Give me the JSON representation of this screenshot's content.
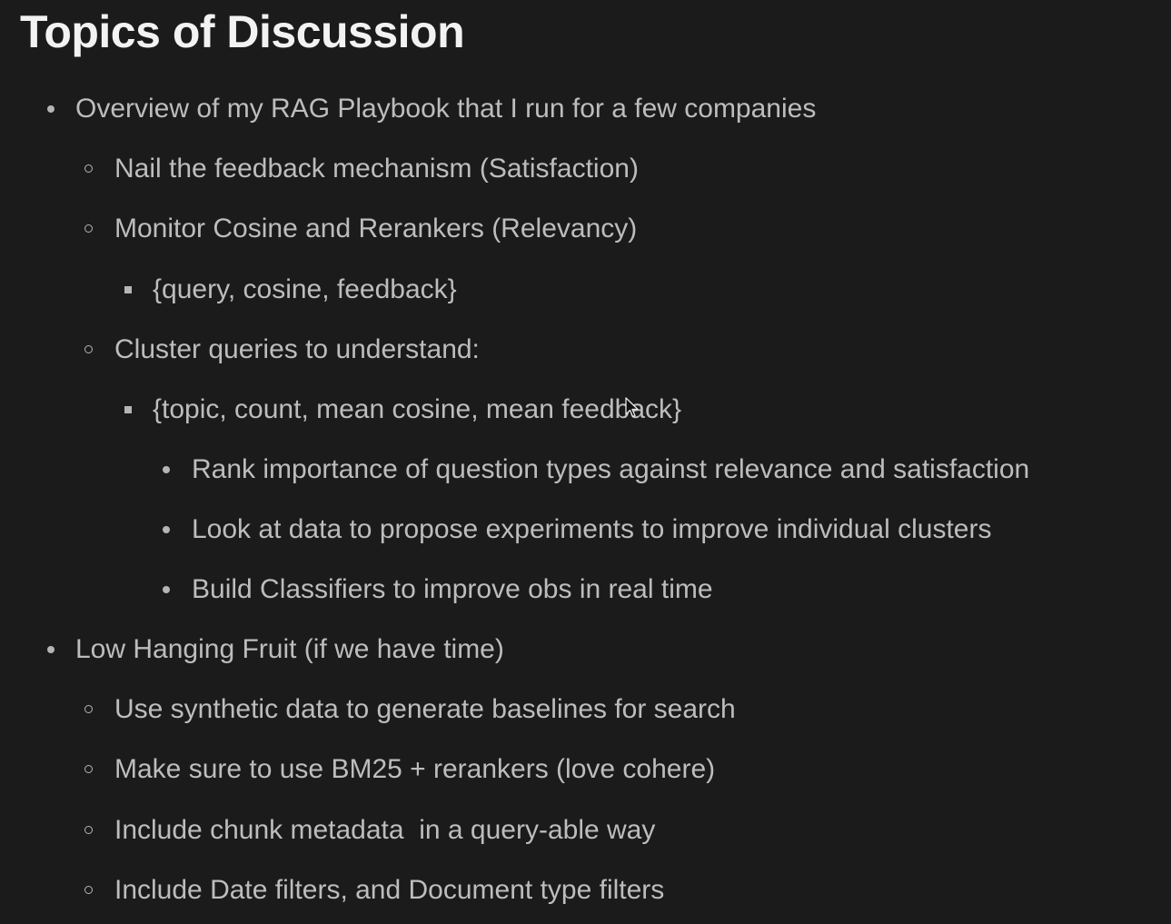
{
  "title": "Topics of Discussion",
  "items": [
    {
      "level": 1,
      "bullet": "disc",
      "text": "Overview of my RAG Playbook that I run for a few companies"
    },
    {
      "level": 2,
      "bullet": "circle",
      "text": "Nail the feedback mechanism (Satisfaction)"
    },
    {
      "level": 2,
      "bullet": "circle",
      "text": "Monitor Cosine and Rerankers (Relevancy)"
    },
    {
      "level": 3,
      "bullet": "square",
      "text": "{query, cosine, feedback}"
    },
    {
      "level": 2,
      "bullet": "circle",
      "text": "Cluster queries to understand:"
    },
    {
      "level": 3,
      "bullet": "square",
      "text": "{topic, count, mean cosine, mean feedback}"
    },
    {
      "level": 4,
      "bullet": "disc",
      "text": "Rank importance of question types against relevance and satisfaction"
    },
    {
      "level": 4,
      "bullet": "disc",
      "text": "Look at data to propose experiments to improve individual clusters"
    },
    {
      "level": 4,
      "bullet": "disc",
      "text": "Build Classifiers to improve obs in real time"
    },
    {
      "level": 1,
      "bullet": "disc",
      "text": "Low Hanging Fruit (if we have time)"
    },
    {
      "level": 2,
      "bullet": "circle",
      "text": "Use synthetic data to generate baselines for search"
    },
    {
      "level": 2,
      "bullet": "circle",
      "text": "Make sure to use BM25 + rerankers (love cohere)"
    },
    {
      "level": 2,
      "bullet": "circle",
      "text": "Include chunk metadata  in a query-able way"
    },
    {
      "level": 2,
      "bullet": "circle",
      "text": "Include Date filters, and Document type filters"
    }
  ],
  "colors": {
    "background": "#1b1b1b",
    "title": "#f2f2f2",
    "body_text": "#bdbdbd"
  }
}
